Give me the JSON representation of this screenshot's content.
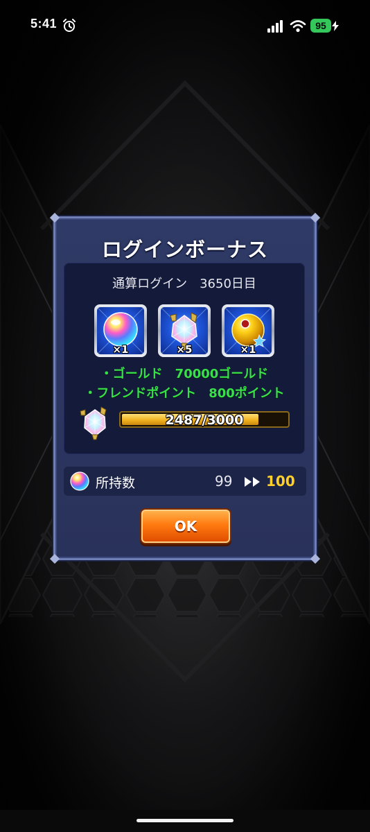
{
  "status_bar": {
    "time": "5:41",
    "battery": "95",
    "icons": [
      "alarm-icon",
      "signal-icon",
      "wifi-icon",
      "charge-icon"
    ]
  },
  "dialog": {
    "title": "ログインボーナス",
    "login_count": "通算ログイン　3650日目",
    "items": [
      {
        "icon": "rainbow-orb-icon",
        "quantity": "×1"
      },
      {
        "icon": "star-gem-shard-icon",
        "quantity": "×5"
      },
      {
        "icon": "gold-orb-icon",
        "quantity": "×1"
      }
    ],
    "rewards": [
      "・ゴールド　70000ゴールド",
      "・フレンドポイント　800ポイント"
    ],
    "progress": {
      "icon": "star-gem-shard-icon",
      "current": 2487,
      "max": 3000,
      "text": "2487/3000"
    },
    "owned": {
      "icon": "rainbow-orb-icon",
      "label": "所持数",
      "before": "99",
      "after": "100"
    },
    "ok_label": "OK"
  },
  "colors": {
    "reward_text": "#39e04a",
    "owned_after": "#ffcf2a",
    "ok_button": "#ff7a10",
    "dialog_bg": "#2f3a66"
  }
}
